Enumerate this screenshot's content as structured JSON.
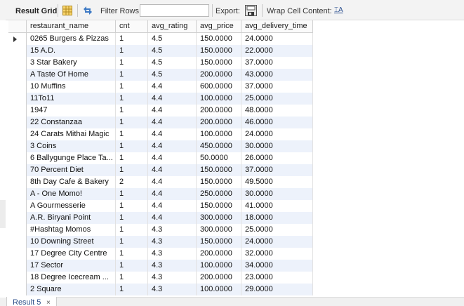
{
  "toolbar": {
    "result_grid_label": "Result Grid",
    "filter_rows_label": "Filter Rows:",
    "filter_rows_value": "",
    "export_label": "Export:",
    "wrap_cell_label": "Wrap Cell Content:",
    "wrap_icon_glyph": "⌶A"
  },
  "grid": {
    "columns": [
      "restaurant_name",
      "cnt",
      "avg_rating",
      "avg_price",
      "avg_delivery_time"
    ],
    "current_row_index": 0,
    "rows": [
      [
        "0265 Burgers & Pizzas",
        "1",
        "4.5",
        "150.0000",
        "24.0000"
      ],
      [
        "15 A.D.",
        "1",
        "4.5",
        "150.0000",
        "22.0000"
      ],
      [
        "3 Star Bakery",
        "1",
        "4.5",
        "150.0000",
        "37.0000"
      ],
      [
        "A Taste Of Home",
        "1",
        "4.5",
        "200.0000",
        "43.0000"
      ],
      [
        "10 Muffins",
        "1",
        "4.4",
        "600.0000",
        "37.0000"
      ],
      [
        "11To11",
        "1",
        "4.4",
        "100.0000",
        "25.0000"
      ],
      [
        "1947",
        "1",
        "4.4",
        "200.0000",
        "48.0000"
      ],
      [
        "22 Constanzaa",
        "1",
        "4.4",
        "200.0000",
        "46.0000"
      ],
      [
        "24 Carats Mithai Magic",
        "1",
        "4.4",
        "100.0000",
        "24.0000"
      ],
      [
        "3 Coins",
        "1",
        "4.4",
        "450.0000",
        "30.0000"
      ],
      [
        "6 Ballygunge Place Ta...",
        "1",
        "4.4",
        "50.0000",
        "26.0000"
      ],
      [
        "70 Percent Diet",
        "1",
        "4.4",
        "150.0000",
        "37.0000"
      ],
      [
        "8th Day Cafe & Bakery",
        "2",
        "4.4",
        "150.0000",
        "49.5000"
      ],
      [
        "A - One Momo!",
        "1",
        "4.4",
        "250.0000",
        "30.0000"
      ],
      [
        "A Gourmesserie",
        "1",
        "4.4",
        "150.0000",
        "41.0000"
      ],
      [
        "A.R. Biryani Point",
        "1",
        "4.4",
        "300.0000",
        "18.0000"
      ],
      [
        "#Hashtag Momos",
        "1",
        "4.3",
        "300.0000",
        "25.0000"
      ],
      [
        "10 Downing Street",
        "1",
        "4.3",
        "150.0000",
        "24.0000"
      ],
      [
        "17 Degree City Centre",
        "1",
        "4.3",
        "200.0000",
        "32.0000"
      ],
      [
        "17 Sector",
        "1",
        "4.3",
        "100.0000",
        "34.0000"
      ],
      [
        "18 Degree Icecream ...",
        "1",
        "4.3",
        "200.0000",
        "23.0000"
      ],
      [
        "2 Square",
        "1",
        "4.3",
        "100.0000",
        "29.0000"
      ]
    ]
  },
  "result_tab": {
    "label": "Result 5",
    "close_glyph": "×"
  },
  "colors": {
    "row_stripe": "#edf2fb",
    "accent": "#2b4f8a"
  }
}
